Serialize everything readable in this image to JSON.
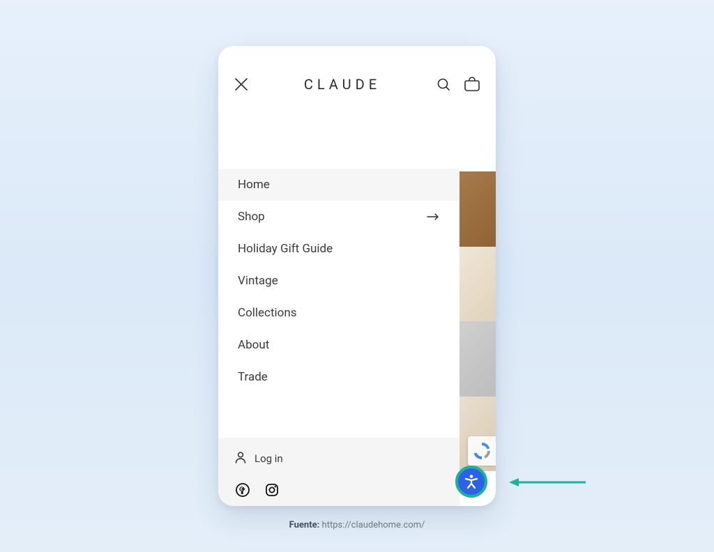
{
  "header": {
    "brand": "CLAUDE"
  },
  "menu": {
    "items": [
      {
        "label": "Home",
        "active": true,
        "has_submenu": false
      },
      {
        "label": "Shop",
        "active": false,
        "has_submenu": true
      },
      {
        "label": "Holiday Gift Guide",
        "active": false,
        "has_submenu": false
      },
      {
        "label": "Vintage",
        "active": false,
        "has_submenu": false
      },
      {
        "label": "Collections",
        "active": false,
        "has_submenu": false
      },
      {
        "label": "About",
        "active": false,
        "has_submenu": false
      },
      {
        "label": "Trade",
        "active": false,
        "has_submenu": false
      }
    ]
  },
  "footer": {
    "login_label": "Log in"
  },
  "caption": {
    "prefix": "Fuente: ",
    "url_text": "https://claudehome.com/"
  },
  "colors": {
    "accent_teal": "#19b39a",
    "widget_blue": "#2e62e6"
  }
}
